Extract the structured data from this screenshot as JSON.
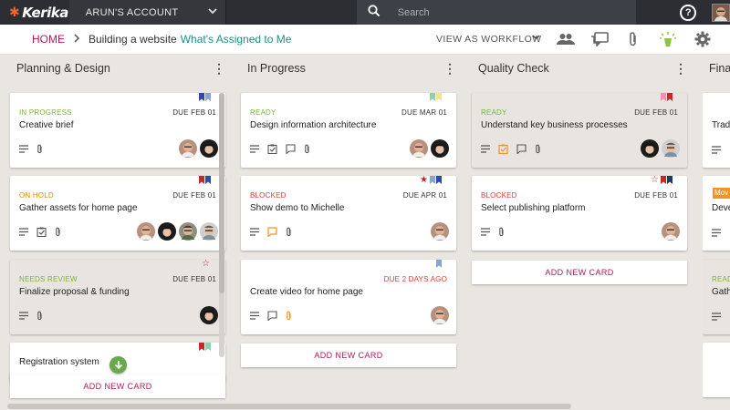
{
  "app": {
    "logo": "Kerika",
    "account": "ARUN'S ACCOUNT",
    "search_placeholder": "Search"
  },
  "breadcrumb": {
    "home": "HOME",
    "board": "Building a website",
    "filter": "What's Assigned to Me",
    "view_as": "VIEW AS WORKFLOW"
  },
  "colors": {
    "brand_magenta": "#b2195b",
    "teal_link": "#1b8f87",
    "status_green": "#7cb342",
    "status_orange": "#e08a00",
    "status_red": "#e53935"
  },
  "columns": [
    {
      "title": "Planning & Design",
      "add_label": "ADD NEW CARD",
      "cards": [
        {
          "status": "IN PROGRESS",
          "status_color": "#7cb342",
          "due": "DUE FEB 01",
          "title": "Creative brief",
          "icons": [
            "notes-icon",
            "attachment-icon"
          ],
          "avatars": 2
        },
        {
          "status": "ON HOLD",
          "status_color": "#e08a00",
          "due": "DUE FEB 01",
          "title": "Gather assets for home page",
          "icons": [
            "notes-icon",
            "checklist-icon",
            "attachment-icon"
          ],
          "avatars": 4
        },
        {
          "status": "NEEDS REVIEW",
          "status_color": "#7cb342",
          "due": "DUE FEB 01",
          "title": "Finalize proposal & funding",
          "icons": [
            "notes-icon",
            "attachment-icon"
          ],
          "avatars": 1
        },
        {
          "status": "",
          "status_color": "#7cb342",
          "due": "",
          "title": "Registration system",
          "icons": [],
          "avatars": 0
        }
      ]
    },
    {
      "title": "In Progress",
      "add_label": "ADD NEW CARD",
      "cards": [
        {
          "status": "READY",
          "status_color": "#7cb342",
          "due": "DUE MAR 01",
          "title": "Design information architecture",
          "icons": [
            "notes-icon",
            "checklist-icon",
            "chat-icon",
            "attachment-icon"
          ],
          "avatars": 2
        },
        {
          "status": "BLOCKED",
          "status_color": "#e53935",
          "due": "DUE APR 01",
          "title": "Show demo to Michelle",
          "icons": [
            "notes-icon",
            "chat-icon",
            "attachment-icon"
          ],
          "avatars": 1
        },
        {
          "status": "",
          "status_color": "#7cb342",
          "due": "DUE 2 DAYS AGO",
          "title": "Create video for home page",
          "icons": [
            "notes-icon",
            "chat-icon",
            "attachment-icon"
          ],
          "avatars": 1
        }
      ]
    },
    {
      "title": "Quality Check",
      "add_label": "ADD NEW CARD",
      "cards": [
        {
          "status": "READY",
          "status_color": "#7cb342",
          "due": "DUE FEB 01",
          "title": "Understand key business processes",
          "icons": [
            "notes-icon",
            "checklist-icon",
            "chat-icon",
            "attachment-icon"
          ],
          "avatars": 2
        },
        {
          "status": "BLOCKED",
          "status_color": "#e53935",
          "due": "DUE FEB 01",
          "title": "Select publishing platform",
          "icons": [
            "notes-icon",
            "attachment-icon"
          ],
          "avatars": 1
        }
      ]
    },
    {
      "title": "Fina",
      "cards": [
        {
          "title": "Trad"
        },
        {
          "status": "Mov",
          "title": "Deve"
        },
        {
          "status": "READ",
          "title": "Gath"
        }
      ]
    }
  ]
}
